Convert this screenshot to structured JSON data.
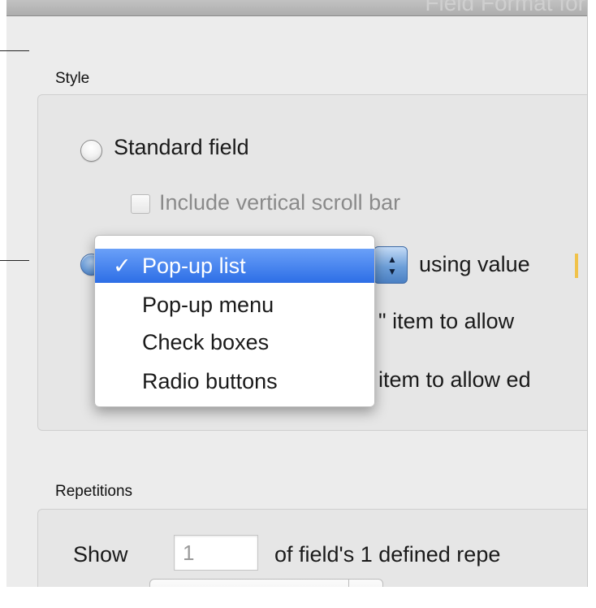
{
  "window": {
    "title": "Field Format for"
  },
  "style": {
    "section_label": "Style",
    "standard_field": {
      "label": "Standard field",
      "selected": false
    },
    "include_scroll_bar": {
      "label": "Include vertical scroll bar",
      "checked": false,
      "enabled": false
    },
    "value_list_row": {
      "selected": true,
      "using_value_label": "using value"
    },
    "hidden_row1_label": "\" item to allow",
    "hidden_row2_label": "item to allow ed"
  },
  "popup_menu": {
    "checkmark": "✓",
    "items": [
      {
        "label": "Pop-up list",
        "selected": true
      },
      {
        "label": "Pop-up menu",
        "selected": false
      },
      {
        "label": "Check boxes",
        "selected": false
      },
      {
        "label": "Radio buttons",
        "selected": false
      }
    ]
  },
  "repetitions": {
    "section_label": "Repetitions",
    "show_label": "Show",
    "show_value": "1",
    "suffix_label": "of field's 1 defined repe"
  },
  "colors": {
    "accent": "#2d6ee6",
    "window_bg": "#ececec"
  },
  "icons": {
    "up_arrow": "▲",
    "down_arrow": "▼"
  }
}
